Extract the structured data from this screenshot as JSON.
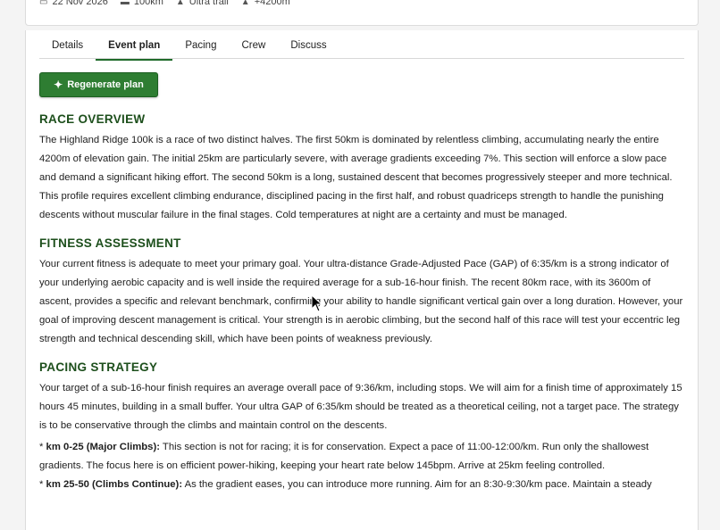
{
  "meta": {
    "date": "22 Nov 2026",
    "distance": "100km",
    "type": "Ultra trail",
    "elevation": "+4200m"
  },
  "tabs": [
    {
      "label": "Details"
    },
    {
      "label": "Event plan"
    },
    {
      "label": "Pacing"
    },
    {
      "label": "Crew"
    },
    {
      "label": "Discuss"
    }
  ],
  "regenerate_label": "Regenerate plan",
  "sections": {
    "race_overview": {
      "title": "RACE OVERVIEW",
      "text": "The Highland Ridge 100k is a race of two distinct halves. The first 50km is dominated by relentless climbing, accumulating nearly the entire 4200m of elevation gain. The initial 25km are particularly severe, with average gradients exceeding 7%. This section will enforce a slow pace and demand a significant hiking effort. The second 50km is a long, sustained descent that becomes progressively steeper and more technical. This profile requires excellent climbing endurance, disciplined pacing in the first half, and robust quadriceps strength to handle the punishing descents without muscular failure in the final stages. Cold temperatures at night are a certainty and must be managed."
    },
    "fitness_assessment": {
      "title": "FITNESS ASSESSMENT",
      "text": "Your current fitness is adequate to meet your primary goal. Your ultra-distance Grade-Adjusted Pace (GAP) of 6:35/km is a strong indicator of your underlying aerobic capacity and is well inside the required average for a sub-16-hour finish. The recent 80km race, with its 3600m of ascent, provides a specific and relevant benchmark, confirming your ability to handle significant vertical gain over a long duration. However, your goal of improving descent management is critical. Your strength is in aerobic climbing, but the second half of this race will test your eccentric leg strength and technical descending skill, which have been points of weakness previously."
    },
    "pacing_strategy": {
      "title": "PACING STRATEGY",
      "text": "Your target of a sub-16-hour finish requires an average overall pace of 9:36/km, including stops. We will aim for a finish time of approximately 15 hours 45 minutes, building in a small buffer. Your ultra GAP of 6:35/km should be treated as a theoretical ceiling, not a target pace. The strategy is to be conservative through the climbs and maintain control on the descents.",
      "bullet1_prefix": "* ",
      "bullet1_label": "km 0-25 (Major Climbs):",
      "bullet1_text": " This section is not for racing; it is for conservation. Expect a pace of 11:00-12:00/km. Run only the shallowest gradients. The focus here is on efficient power-hiking, keeping your heart rate below 145bpm. Arrive at 25km feeling controlled.",
      "bullet2_prefix": "* ",
      "bullet2_label": "km 25-50 (Climbs Continue):",
      "bullet2_text": " As the gradient eases, you can introduce more running. Aim for an 8:30-9:30/km pace. Maintain a steady"
    }
  }
}
